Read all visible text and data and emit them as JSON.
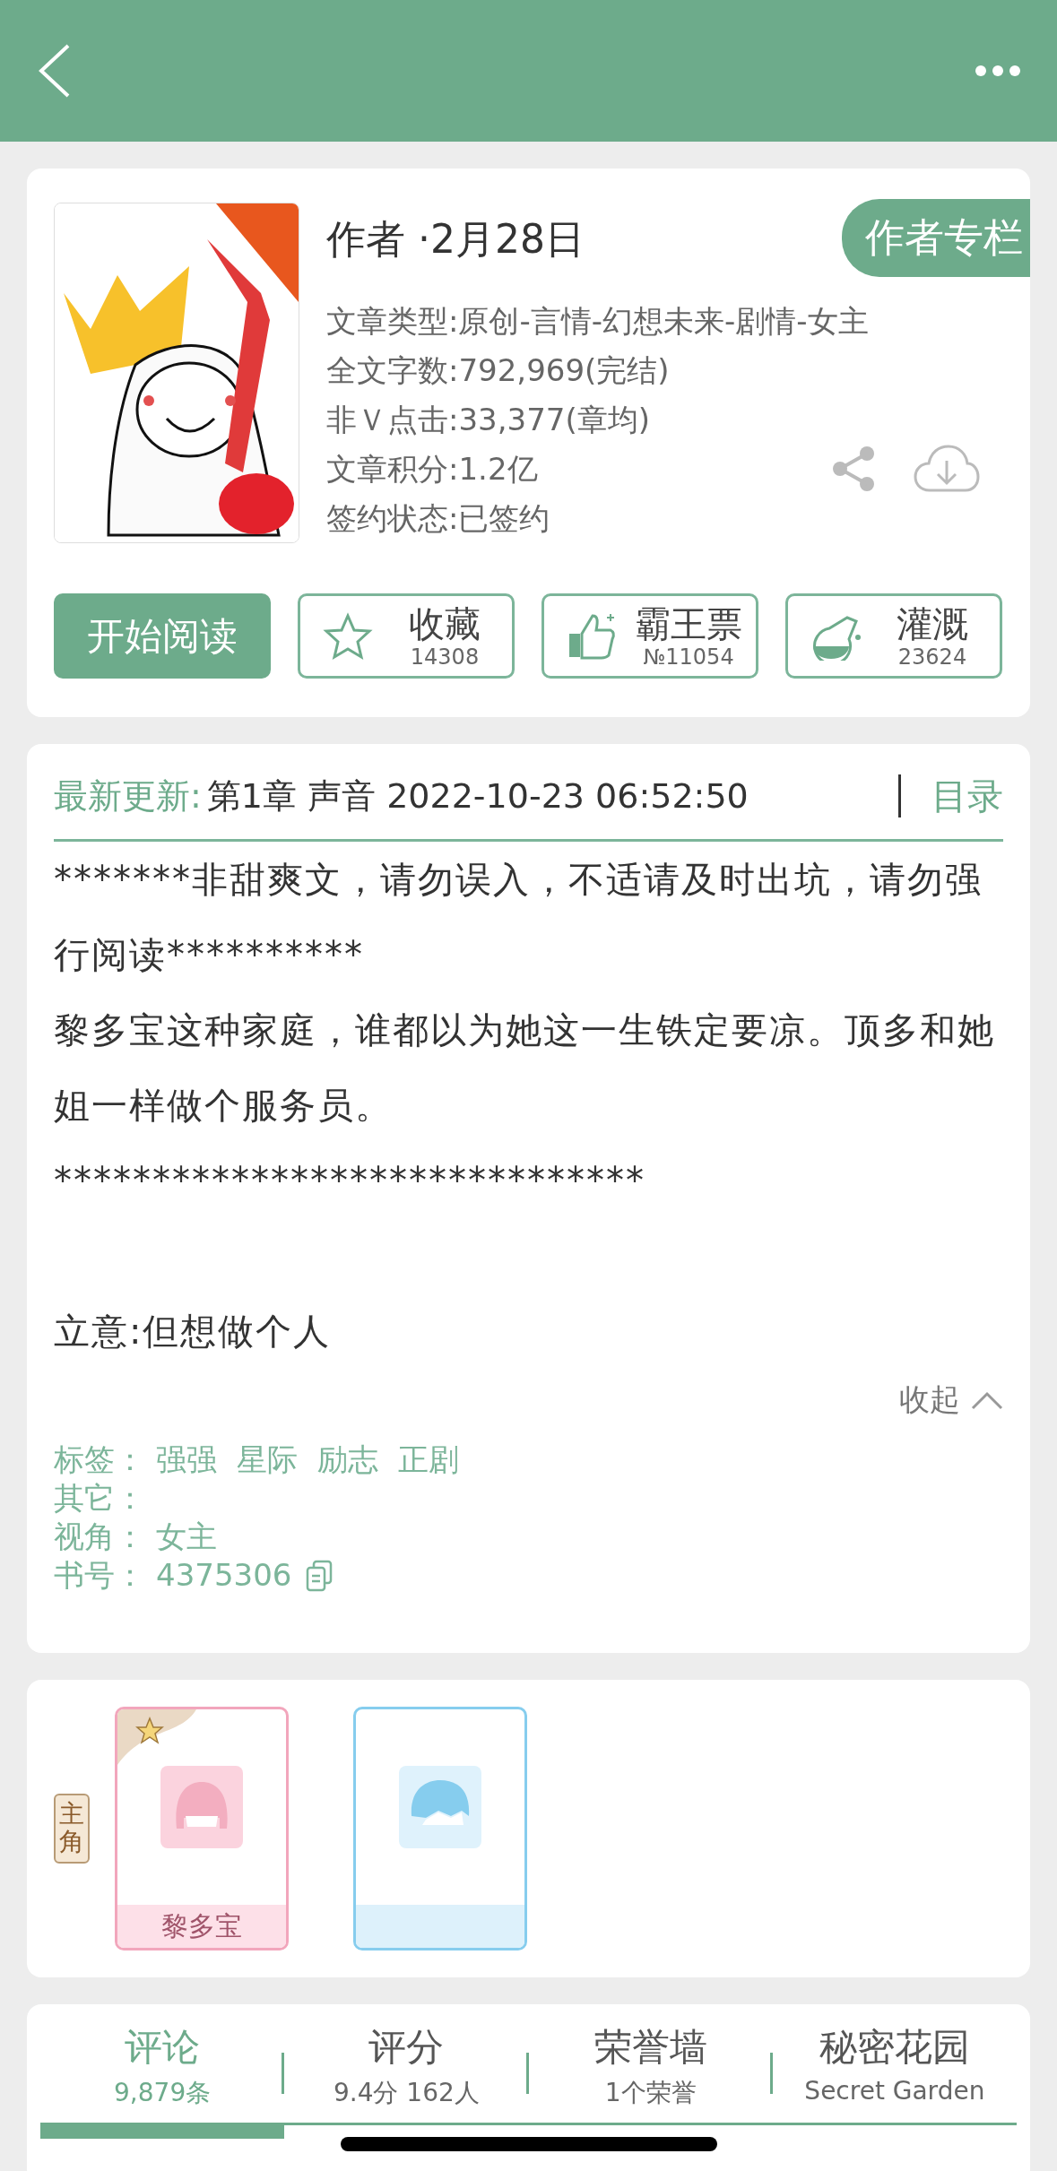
{
  "book": {
    "author_line": "作者 ·2月28日",
    "column_button": "作者专栏",
    "info": [
      "文章类型:原创-言情-幻想未来-剧情-女主",
      "全文字数:792,969(完结)",
      "非Ｖ点击:33,377(章均)",
      "文章积分:1.2亿",
      "签约状态:已签约"
    ]
  },
  "actions": [
    {
      "kind": "primary",
      "label": "开始阅读"
    },
    {
      "kind": "star",
      "label": "收藏",
      "count": "14308"
    },
    {
      "kind": "thumb",
      "label": "霸王票",
      "count": "№11054"
    },
    {
      "kind": "flask",
      "label": "灌溉",
      "count": "23624"
    }
  ],
  "update": {
    "label": "最新更新:",
    "chapter": "第1章 声音 2022-10-23 06:52:50",
    "catalog": "目录"
  },
  "intro": {
    "paragraphs": [
      "*******非甜爽文，请勿误入，不适请及时出坑，请勿强行阅读**********",
      "黎多宝这种家庭，谁都以为她这一生铁定要凉。顶多和她姐一样做个服务员。",
      "******************************"
    ],
    "statement": "立意:但想做个人",
    "collapse": "收起"
  },
  "meta": [
    {
      "label": "标签：",
      "values": [
        "强强",
        "星际",
        "励志",
        "正剧"
      ]
    },
    {
      "label": "其它："
    },
    {
      "label": "视角：",
      "values": [
        "女主"
      ]
    },
    {
      "label": "书号：",
      "values": [
        "4375306"
      ],
      "copyable": true
    }
  ],
  "characters": {
    "role_tag": "主角",
    "cards": [
      {
        "kind": "female",
        "name": "黎多宝",
        "color": "#f2a6bc",
        "starred": true
      },
      {
        "kind": "male",
        "color": "#86cdee",
        "starred": false
      }
    ]
  },
  "tabs": [
    {
      "label": "评论",
      "sub": "9,879条",
      "selected": true
    },
    {
      "label": "评分",
      "sub": "9.4分 162人",
      "selected": false
    },
    {
      "label": "荣誉墙",
      "sub": "1个荣誉",
      "selected": false
    },
    {
      "label": "秘密花园",
      "sub": "Secret Garden",
      "selected": false
    }
  ]
}
